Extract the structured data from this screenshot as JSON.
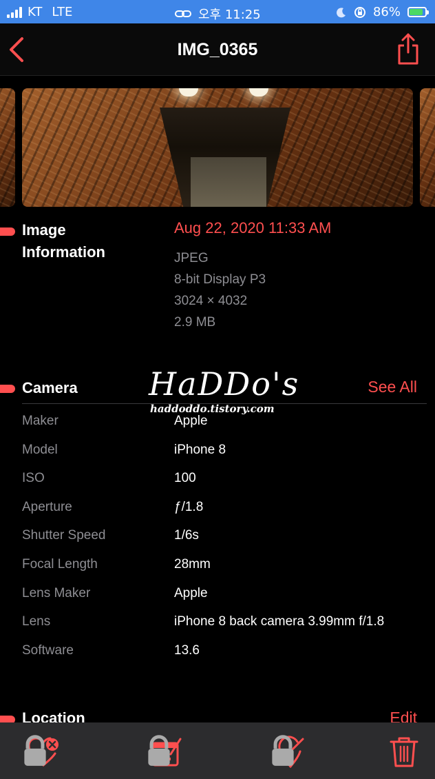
{
  "status_bar": {
    "carrier": "KT",
    "network": "LTE",
    "time": "오후 11:25",
    "battery_percent": "86%",
    "battery_level": 0.86
  },
  "nav": {
    "title": "IMG_0365"
  },
  "image_info": {
    "title_line1": "Image",
    "title_line2": "Information",
    "date": "Aug 22, 2020 11:33 AM",
    "format": "JPEG",
    "color_profile": "8-bit Display P3",
    "dimensions": "3024 × 4032",
    "file_size": "2.9 MB"
  },
  "camera": {
    "title": "Camera",
    "see_all": "See All",
    "rows": [
      {
        "label": "Maker",
        "value": "Apple"
      },
      {
        "label": "Model",
        "value": "iPhone 8"
      },
      {
        "label": "ISO",
        "value": "100"
      },
      {
        "label": "Aperture",
        "value": "ƒ/1.8"
      },
      {
        "label": "Shutter Speed",
        "value": "1/6s"
      },
      {
        "label": "Focal Length",
        "value": "28mm"
      },
      {
        "label": "Lens Maker",
        "value": "Apple"
      },
      {
        "label": "Lens",
        "value": "iPhone 8 back camera 3.99mm f/1.8"
      },
      {
        "label": "Software",
        "value": "13.6"
      }
    ]
  },
  "location": {
    "title": "Location",
    "edit": "Edit"
  },
  "watermark": {
    "logo": "HaDDo's",
    "url": "haddoddo.tistory.com"
  },
  "icons": {
    "back": "chevron-left-icon",
    "share": "share-icon",
    "remove_favorite": "heart-remove-icon",
    "edit_date": "calendar-edit-icon",
    "edit_location": "location-edit-icon",
    "delete": "trash-icon"
  },
  "colors": {
    "accent": "#ff4f4f",
    "status_bar": "#3f86e8",
    "secondary_text": "#8e8e93",
    "toolbar": "#2c2c2e"
  }
}
